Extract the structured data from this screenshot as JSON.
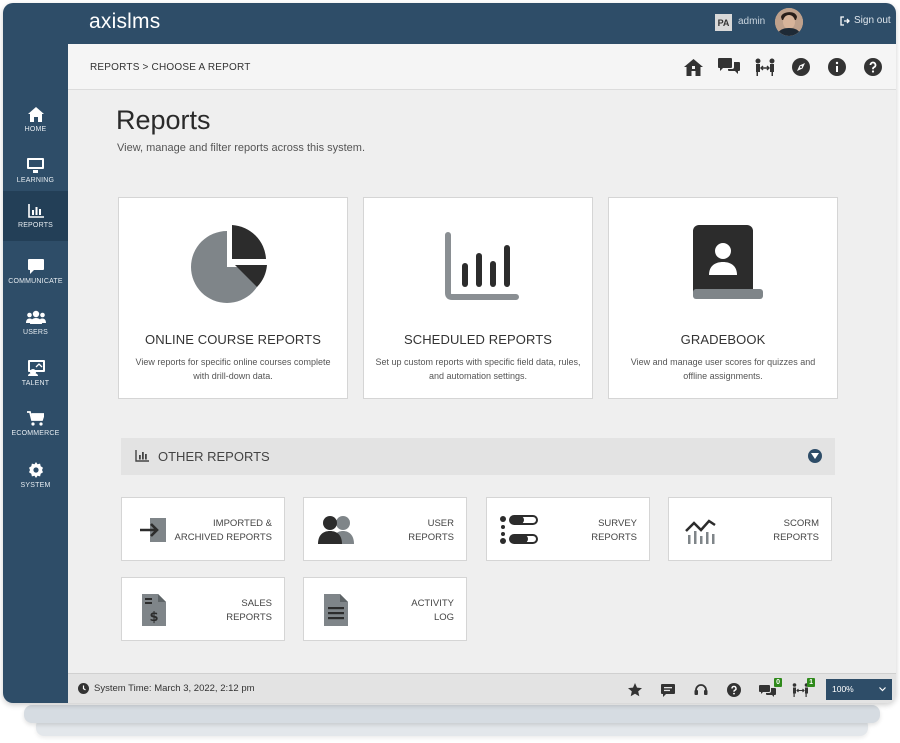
{
  "app": {
    "logo": "axislms"
  },
  "topbar": {
    "user_initials": "PA",
    "user_name": "admin",
    "signout_label": "Sign out"
  },
  "breadcrumb": {
    "text": "REPORTS  > CHOOSE A REPORT"
  },
  "sidebar": {
    "items": [
      {
        "label": "HOME",
        "icon": "home-icon"
      },
      {
        "label": "LEARNING",
        "icon": "monitor-icon"
      },
      {
        "label": "REPORTS",
        "icon": "bar-chart-icon"
      },
      {
        "label": "COMMUNICATE",
        "icon": "chat-icon"
      },
      {
        "label": "USERS",
        "icon": "users-icon"
      },
      {
        "label": "TALENT",
        "icon": "talent-icon"
      },
      {
        "label": "ECOMMERCE",
        "icon": "cart-icon"
      },
      {
        "label": "SYSTEM",
        "icon": "gear-icon"
      }
    ]
  },
  "page": {
    "title": "Reports",
    "subtitle": "View, manage and filter reports across this system."
  },
  "cards": [
    {
      "title": "ONLINE COURSE REPORTS",
      "desc_line1": "View reports for specific online courses complete",
      "desc_line2": "with drill-down data."
    },
    {
      "title": "SCHEDULED REPORTS",
      "desc_line1": "Set up custom reports with specific field data, rules,",
      "desc_line2": "and automation settings."
    },
    {
      "title": "GRADEBOOK",
      "desc_line1": "View and manage user scores for quizzes and",
      "desc_line2": "offline assignments."
    }
  ],
  "other_reports": {
    "header": "OTHER REPORTS",
    "items": [
      {
        "line1": "IMPORTED &",
        "line2": "ARCHIVED REPORTS"
      },
      {
        "line1": "USER",
        "line2": "REPORTS"
      },
      {
        "line1": "SURVEY",
        "line2": "REPORTS"
      },
      {
        "line1": "SCORM",
        "line2": "REPORTS"
      },
      {
        "line1": "SALES",
        "line2": "REPORTS"
      },
      {
        "line1": "ACTIVITY",
        "line2": "LOG"
      }
    ]
  },
  "footer": {
    "system_time_label": "System Time:",
    "system_time_value": "March 3, 2022, 2:12 pm",
    "chat_badge": "0",
    "connections_badge": "1",
    "zoom": "100%"
  },
  "colors": {
    "primary": "#2e4d68",
    "icon": "#333333",
    "badge": "#2f8a1b"
  }
}
